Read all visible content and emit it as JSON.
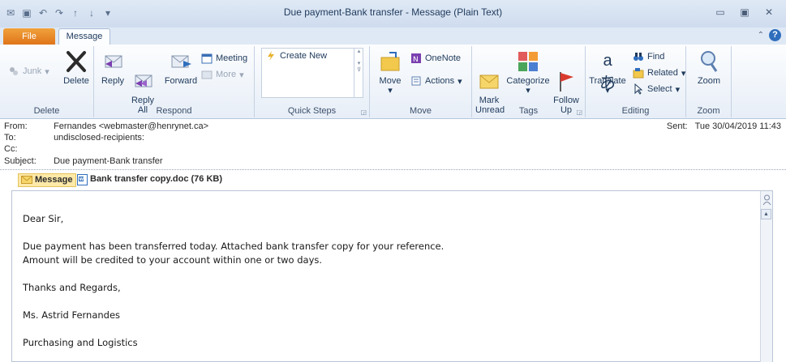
{
  "window": {
    "title": "Due payment-Bank transfer  -  Message (Plain Text)",
    "min": "▭",
    "restore": "▣",
    "close": "✕"
  },
  "tabs": {
    "file": "File",
    "message": "Message",
    "help": "?"
  },
  "ribbon": {
    "delete": {
      "junk": "Junk",
      "delete": "Delete",
      "group": "Delete"
    },
    "respond": {
      "reply": "Reply",
      "reply_all": "Reply\nAll",
      "forward": "Forward",
      "meeting": "Meeting",
      "more": "More",
      "group": "Respond"
    },
    "quick_steps": {
      "create_new": "Create New",
      "group": "Quick Steps"
    },
    "move": {
      "move": "Move",
      "onenote": "OneNote",
      "actions": "Actions",
      "group": "Move"
    },
    "tags": {
      "mark_unread": "Mark\nUnread",
      "categorize": "Categorize",
      "follow_up": "Follow\nUp",
      "group": "Tags"
    },
    "editing": {
      "translate": "Translate",
      "find": "Find",
      "related": "Related",
      "select": "Select",
      "group": "Editing"
    },
    "zoom": {
      "zoom": "Zoom",
      "group": "Zoom"
    }
  },
  "header": {
    "from_label": "From:",
    "from": "Fernandes <webmaster@henrynet.ca>",
    "to_label": "To:",
    "to": "undisclosed-recipients:",
    "cc_label": "Cc:",
    "cc": "",
    "subject_label": "Subject:",
    "subject": "Due payment-Bank transfer",
    "sent_label": "Sent:",
    "sent": "Tue 30/04/2019 11:43"
  },
  "attachments": {
    "message_tab": "Message",
    "file": "Bank transfer copy.doc (76 KB)"
  },
  "body": {
    "greeting": "Dear Sir,",
    "line1": "Due payment has been transferred today. Attached bank transfer copy for your reference.",
    "line2": "Amount will be credited to your account within one or two days.",
    "closing": "Thanks and Regards,",
    "name": "Ms. Astrid Fernandes",
    "dept": "Purchasing and Logistics"
  }
}
